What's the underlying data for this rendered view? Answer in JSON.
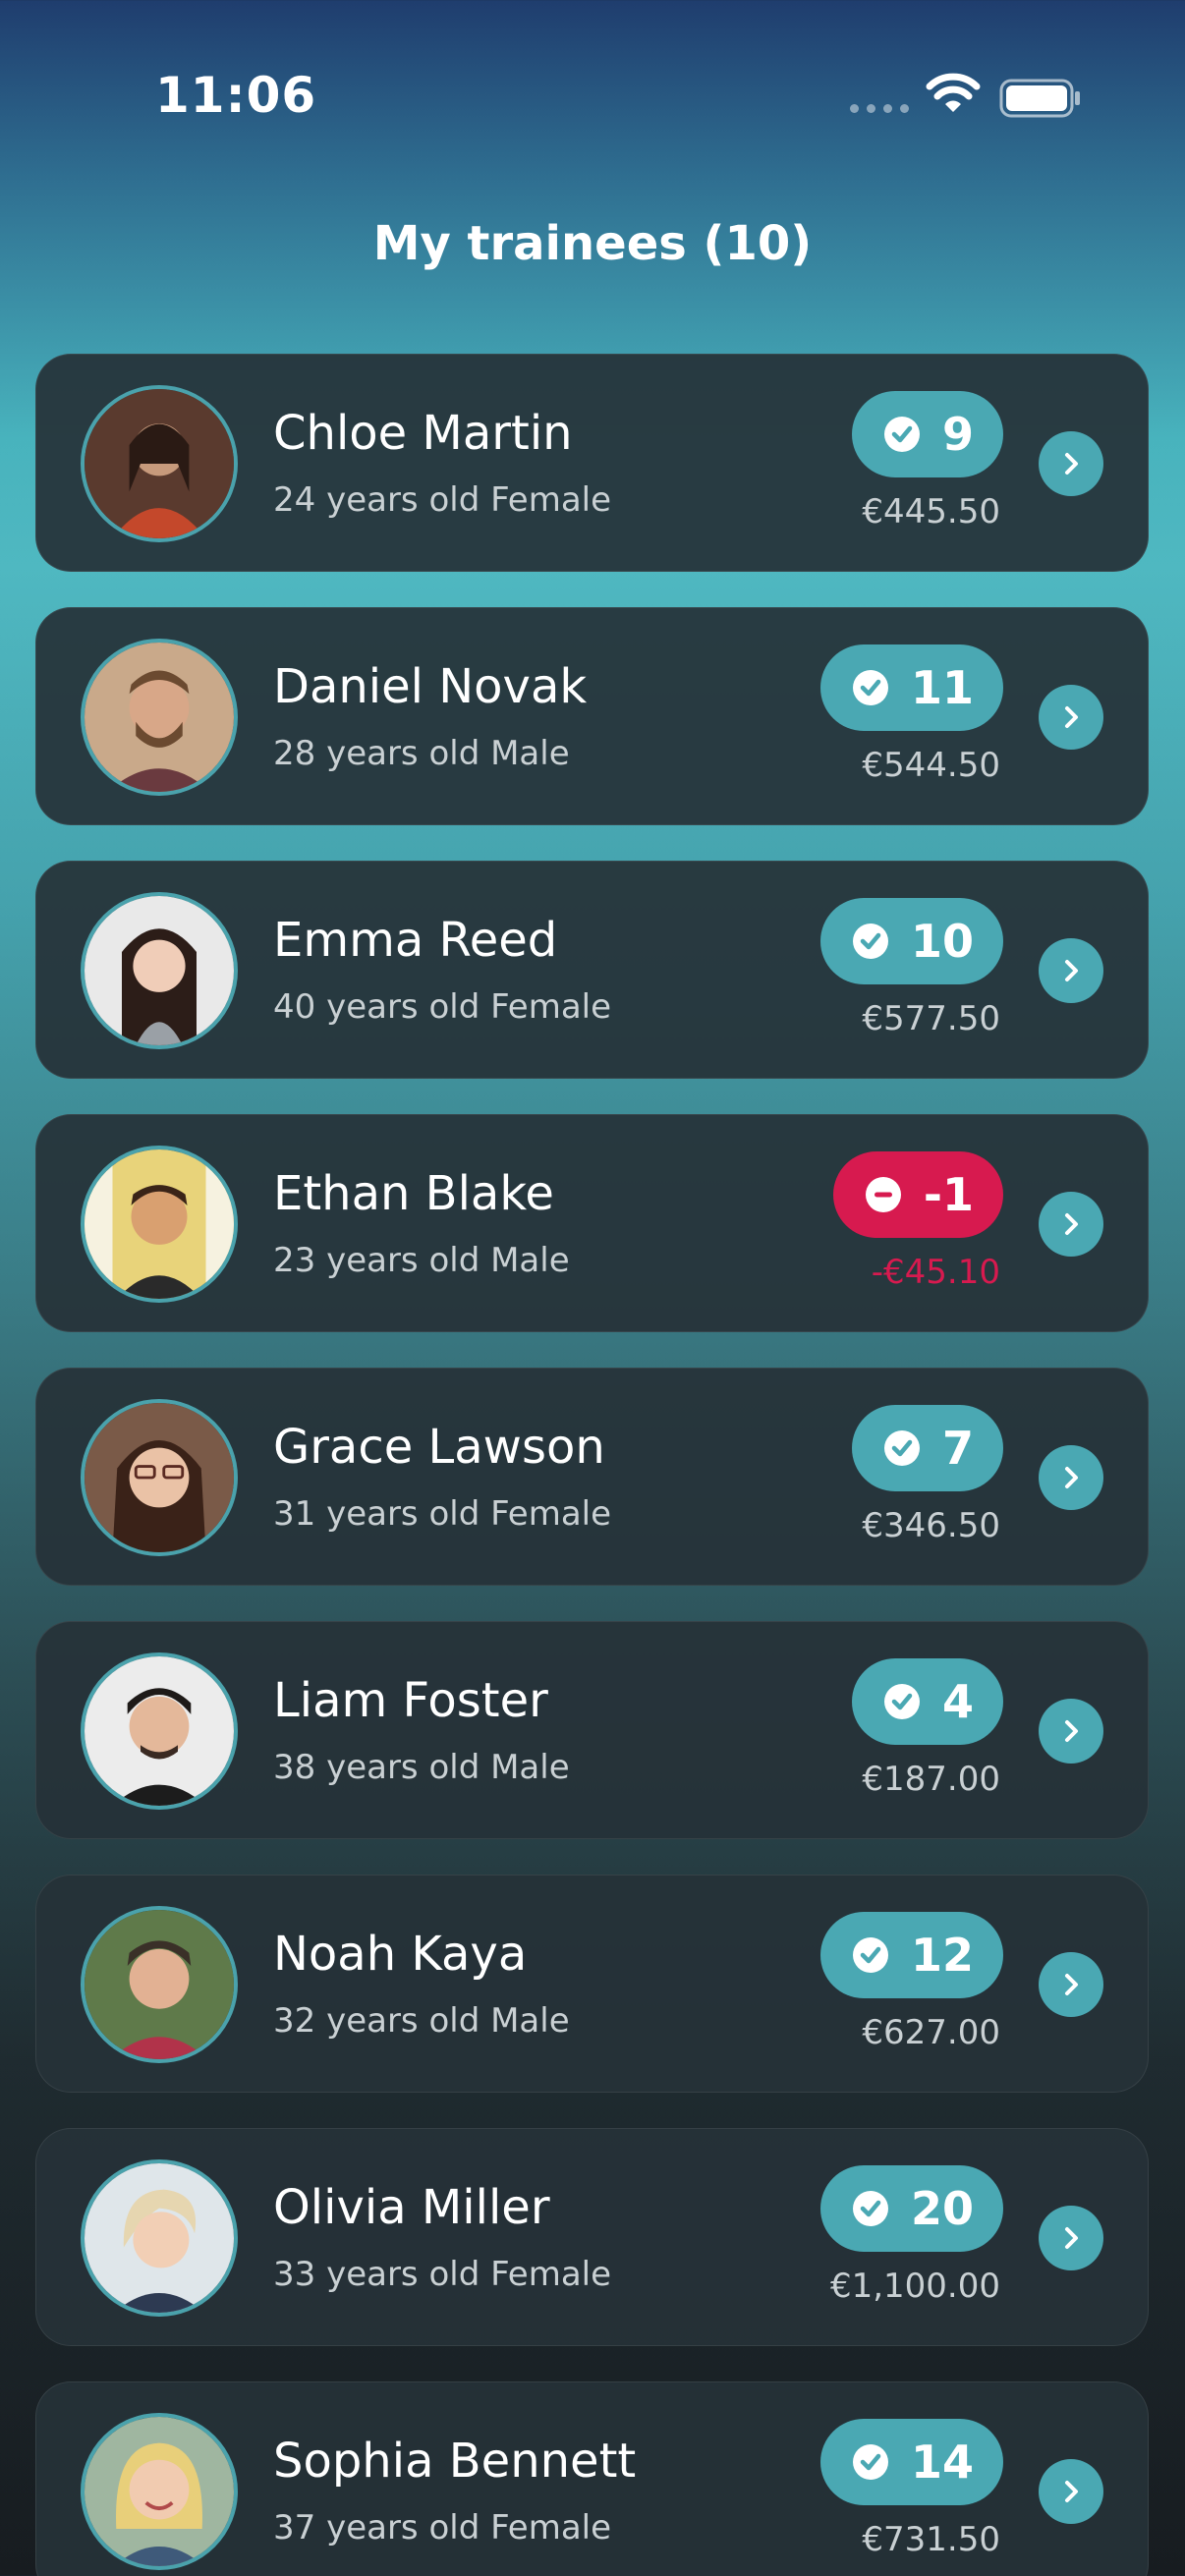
{
  "status_bar": {
    "time": "11:06"
  },
  "header": {
    "title": "My trainees (10)"
  },
  "colors": {
    "accent": "#4aa8b3",
    "negative": "#d71a4f",
    "card": "#263238"
  },
  "trainees": [
    {
      "name": "Chloe Martin",
      "details": "24 years old Female",
      "count": "9",
      "amount": "€445.50",
      "status": "positive"
    },
    {
      "name": "Daniel Novak",
      "details": "28 years old Male",
      "count": "11",
      "amount": "€544.50",
      "status": "positive"
    },
    {
      "name": "Emma Reed",
      "details": "40 years old Female",
      "count": "10",
      "amount": "€577.50",
      "status": "positive"
    },
    {
      "name": "Ethan Blake",
      "details": "23 years old Male",
      "count": "-1",
      "amount": "-€45.10",
      "status": "negative"
    },
    {
      "name": "Grace Lawson",
      "details": "31 years old Female",
      "count": "7",
      "amount": "€346.50",
      "status": "positive"
    },
    {
      "name": "Liam Foster",
      "details": "38 years old Male",
      "count": "4",
      "amount": "€187.00",
      "status": "positive"
    },
    {
      "name": "Noah Kaya",
      "details": "32 years old Male",
      "count": "12",
      "amount": "€627.00",
      "status": "positive"
    },
    {
      "name": "Olivia Miller",
      "details": "33 years old Female",
      "count": "20",
      "amount": "€1,100.00",
      "status": "positive"
    },
    {
      "name": "Sophia Bennett",
      "details": "37 years old Female",
      "count": "14",
      "amount": "€731.50",
      "status": "positive"
    }
  ]
}
